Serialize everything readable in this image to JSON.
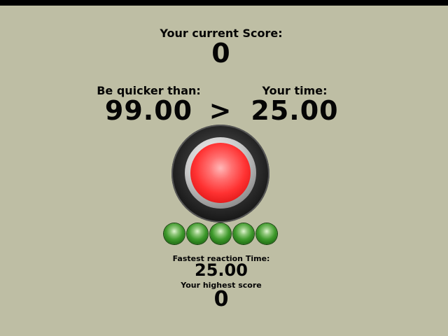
{
  "score": {
    "label": "Your current Score:",
    "value": "0"
  },
  "challenge": {
    "label": "Be quicker than:",
    "value": "99.00",
    "comparator": ">"
  },
  "your_time": {
    "label": "Your time:",
    "value": "25.00"
  },
  "reaction_button": {
    "color": "#ff3232"
  },
  "lights": {
    "count": 5,
    "color": "#3f9a2c"
  },
  "stats": {
    "fastest_label": "Fastest reaction Time:",
    "fastest_value": "25.00",
    "highest_label": "Your highest score",
    "highest_value": "0"
  }
}
